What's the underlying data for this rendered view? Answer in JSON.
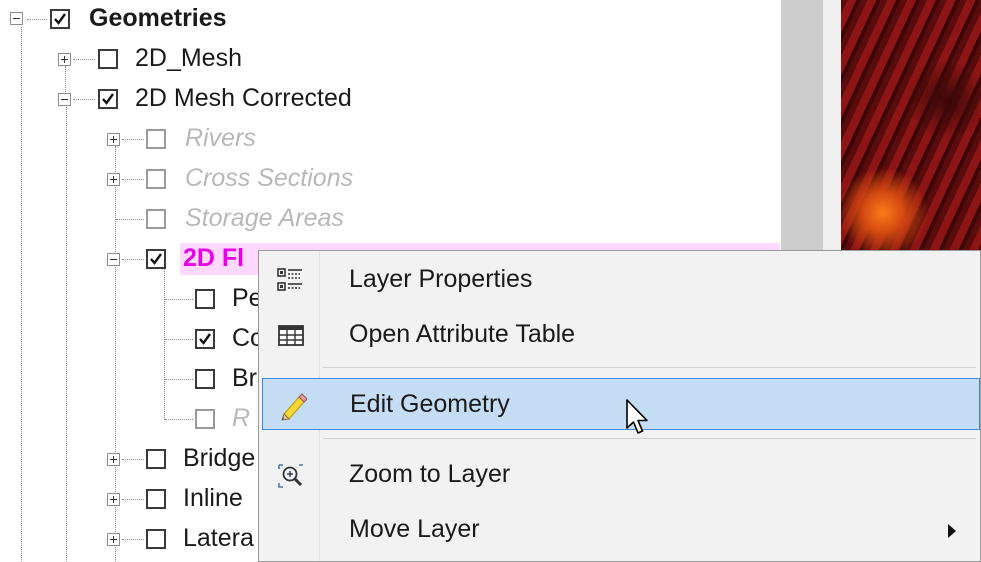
{
  "tree": {
    "root": {
      "label": "Geometries",
      "checked": true
    },
    "mesh": {
      "label": "2D_Mesh",
      "checked": false
    },
    "mesh_corrected": {
      "label": "2D Mesh Corrected",
      "checked": true
    },
    "rivers": {
      "label": "Rivers"
    },
    "cross_sections": {
      "label": "Cross Sections"
    },
    "storage_areas": {
      "label": "Storage Areas"
    },
    "flow_areas": {
      "label": "2D Fl"
    },
    "child1": {
      "label": "Pe"
    },
    "child2": {
      "label": "Co"
    },
    "child3": {
      "label": "Br"
    },
    "child4": {
      "label": "R"
    },
    "bridges": {
      "label": "Bridge"
    },
    "inline": {
      "label": "Inline"
    },
    "lateral": {
      "label": "Latera"
    }
  },
  "menu": {
    "items": [
      {
        "label": "Layer Properties",
        "icon": "layer-properties-icon"
      },
      {
        "label": "Open Attribute Table",
        "icon": "table-icon"
      },
      {
        "label": "Edit Geometry",
        "icon": "pencil-icon"
      },
      {
        "label": "Zoom to Layer",
        "icon": "zoom-icon"
      },
      {
        "label": "Move Layer",
        "icon": "none"
      }
    ]
  },
  "colors": {
    "highlight": "#c5ddf4",
    "pink_text": "#e800e8",
    "pink_row": "#ffd8ff"
  }
}
